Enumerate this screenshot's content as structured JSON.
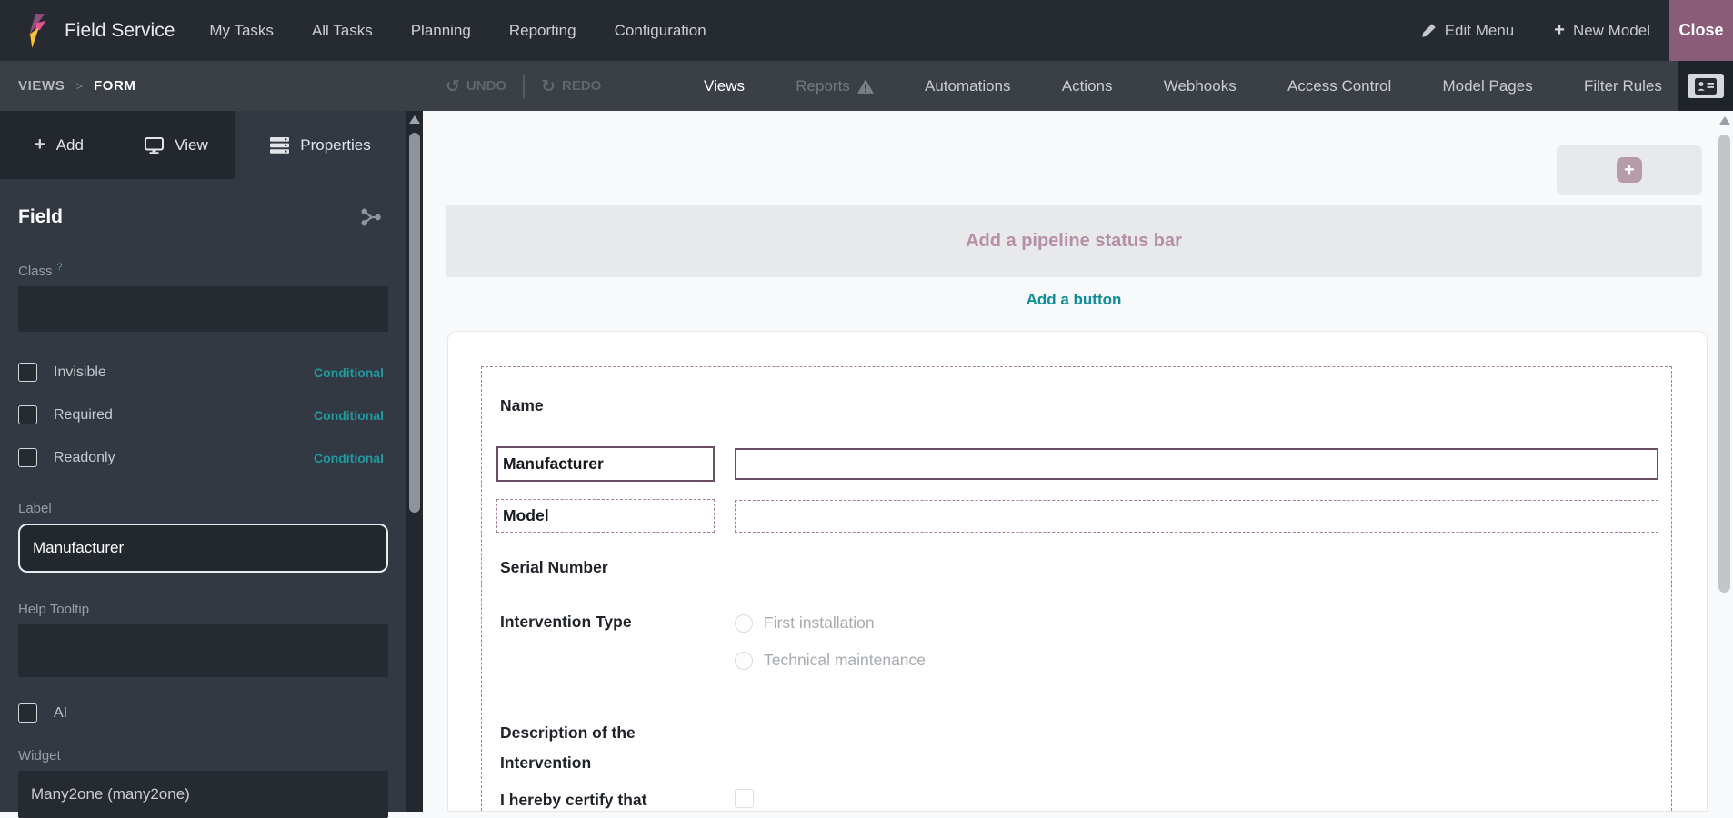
{
  "colors": {
    "close_button": "#8a5c77",
    "selection_purple": "#6b4e63",
    "dashed_purple": "#a3819a",
    "teal_link": "#0c8e94",
    "conditional_teal": "#1d9ba0",
    "placeholder_mauve": "#b48fa7"
  },
  "navbar": {
    "app_name": "Field Service",
    "menu": [
      "My Tasks",
      "All Tasks",
      "Planning",
      "Reporting",
      "Configuration"
    ],
    "edit_menu": "Edit Menu",
    "new_model": "New Model",
    "new_model_plus": "+",
    "close": "Close"
  },
  "toolbar": {
    "breadcrumb_root": "VIEWS",
    "breadcrumb_sep": ">",
    "breadcrumb_current": "FORM",
    "undo": "UNDO",
    "redo": "REDO",
    "undo_icon": "↺",
    "redo_icon": "↻",
    "tabs": [
      "Views",
      "Reports",
      "Automations",
      "Actions",
      "Webhooks",
      "Access Control",
      "Model Pages",
      "Filter Rules"
    ]
  },
  "sidebar": {
    "tabs": [
      {
        "label": "Add",
        "icon": "plus-icon"
      },
      {
        "label": "View",
        "icon": "monitor-icon"
      },
      {
        "label": "Properties",
        "icon": "list-icon"
      }
    ],
    "tab_add_plus": "+",
    "panel_title": "Field",
    "class_label": "Class",
    "class_help_mark": "?",
    "checks": [
      {
        "label": "Invisible",
        "badge": "Conditional",
        "checked": false
      },
      {
        "label": "Required",
        "badge": "Conditional",
        "checked": false
      },
      {
        "label": "Readonly",
        "badge": "Conditional",
        "checked": false
      }
    ],
    "label_section": {
      "label": "Label",
      "value": "Manufacturer"
    },
    "help_tooltip_label": "Help Tooltip",
    "help_tooltip_value": "",
    "ai_label": "AI",
    "ai_checked": false,
    "widget_label": "Widget",
    "widget_value": "Many2one (many2one)"
  },
  "canvas": {
    "plus_button": "+",
    "pipeline_placeholder": "Add a pipeline status bar",
    "add_button_link": "Add a button",
    "form": {
      "name_label": "Name",
      "manufacturer_label": "Manufacturer",
      "manufacturer_value": "",
      "model_label": "Model",
      "model_value": "",
      "serial_label": "Serial Number",
      "intervention_label": "Intervention Type",
      "radio_options": [
        "First installation",
        "Technical maintenance"
      ],
      "description_label": "Description of the Intervention",
      "certify_label": "I hereby certify that"
    }
  }
}
